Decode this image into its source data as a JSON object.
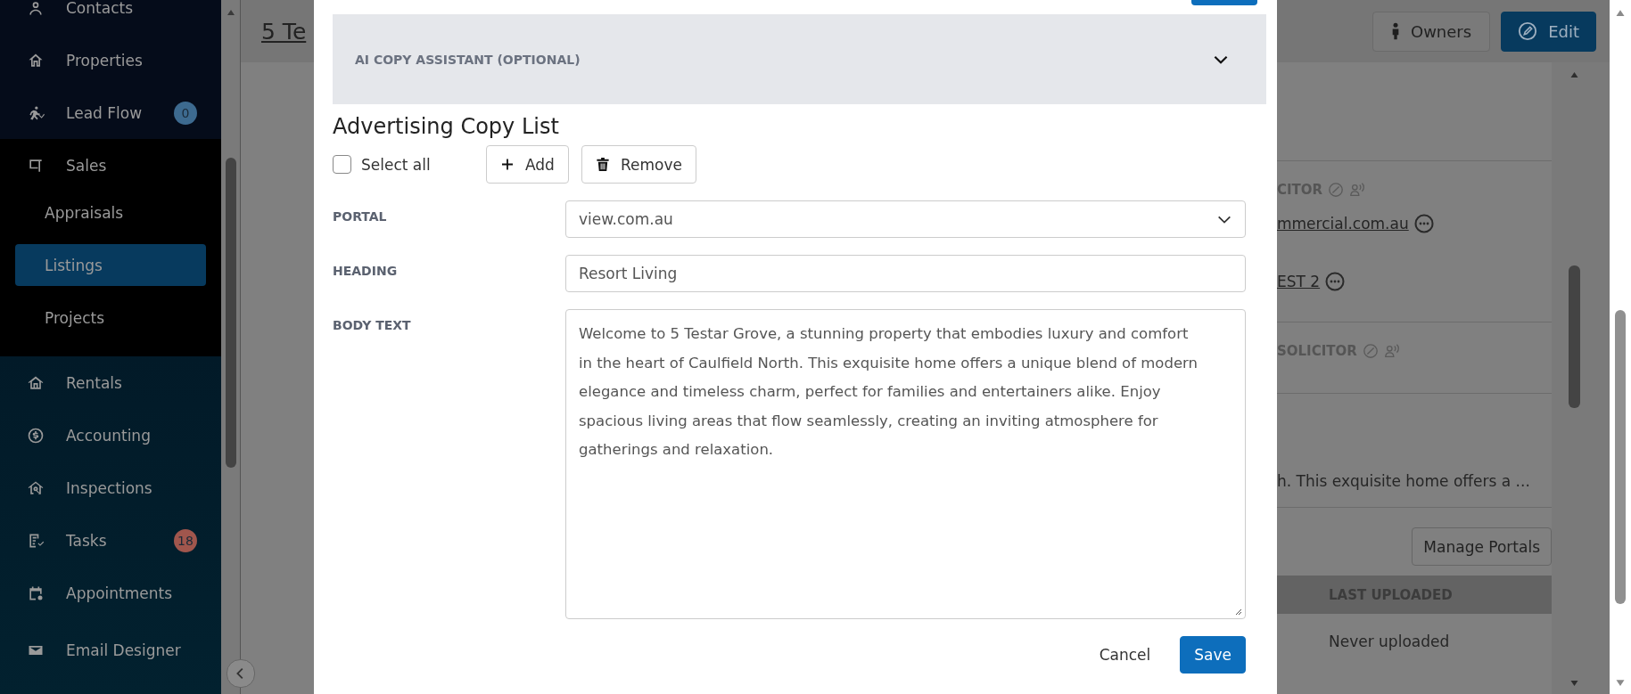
{
  "sidebar": {
    "items": [
      {
        "label": "Contacts",
        "expanded": false
      },
      {
        "label": "Properties",
        "expanded": false
      },
      {
        "label": "Lead Flow",
        "expanded": false,
        "badge": {
          "text": "0",
          "color": "#3d6a8f"
        }
      },
      {
        "label": "Sales",
        "expanded": true,
        "children": [
          {
            "label": "Appraisals",
            "selected": false
          },
          {
            "label": "Listings",
            "selected": true
          },
          {
            "label": "Projects",
            "selected": false
          }
        ]
      },
      {
        "label": "Rentals",
        "expanded": false
      },
      {
        "label": "Accounting",
        "expanded": false
      },
      {
        "label": "Inspections",
        "expanded": false
      },
      {
        "label": "Tasks",
        "expanded": false,
        "badge": {
          "text": "18",
          "color": "#a0564d"
        }
      },
      {
        "label": "Appointments",
        "expanded": false
      },
      {
        "label": "Email Designer",
        "expanded": false
      }
    ]
  },
  "page": {
    "title": "5 Te",
    "header_buttons": [
      {
        "label": "Owners",
        "kind": "secondary"
      },
      {
        "label": "Edit",
        "kind": "primary"
      }
    ],
    "solicitor_heading": "CITOR",
    "contact_links": [
      "mmercial.com.au",
      "EST 2"
    ],
    "second_heading": "SOLICITOR",
    "copy_preview": "h. This exquisite home offers a ...",
    "manage_portals_button": "Manage Portals",
    "portal_table": {
      "columns": [
        "LAST UPLOADED"
      ],
      "rows": [
        [
          "Never uploaded"
        ]
      ]
    }
  },
  "modal": {
    "accordion": {
      "title": "AI COPY ASSISTANT (OPTIONAL)",
      "expanded": false
    },
    "heading": "Advertising Copy List",
    "select_all": {
      "label": "Select all",
      "checked": false
    },
    "actions": [
      {
        "label": "Add",
        "kind": "add"
      },
      {
        "label": "Remove",
        "kind": "remove"
      }
    ],
    "fields": [
      {
        "label": "PORTAL",
        "kind": "select",
        "value": "view.com.au"
      },
      {
        "label": "HEADING",
        "kind": "text",
        "value": "Resort Living"
      },
      {
        "label": "BODY TEXT",
        "kind": "textarea",
        "value": "Welcome to 5 Testar Grove, a stunning property that embodies luxury and comfort in the heart of Caulfield North. This exquisite home offers a unique blend of modern elegance and timeless charm, perfect for families and entertainers alike. Enjoy spacious living areas that flow seamlessly, creating an inviting atmosphere for gatherings and relaxation."
      }
    ],
    "footer_buttons": [
      {
        "label": "Cancel",
        "kind": "link"
      },
      {
        "label": "Save",
        "kind": "primary"
      }
    ]
  }
}
